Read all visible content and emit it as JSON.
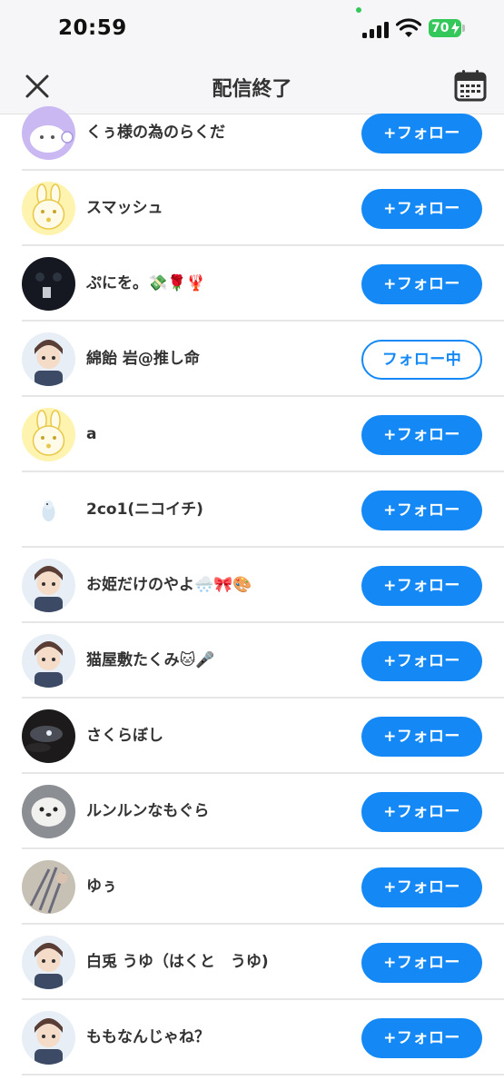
{
  "status_bar": {
    "time": "20:59",
    "battery": "70"
  },
  "nav": {
    "title": "配信終了"
  },
  "users": [
    {
      "name": "くぅ様の為のらくだ",
      "button": "+フォロー",
      "following": false,
      "avatar": "purple-plush-icon"
    },
    {
      "name": "スマッシュ",
      "button": "+フォロー",
      "following": false,
      "avatar": "yellow-bunny-icon"
    },
    {
      "name": "ぷにを。💸🌹🦞",
      "button": "+フォロー",
      "following": false,
      "avatar": "dark-face-icon"
    },
    {
      "name": "綿飴 岩@推し命",
      "button": "フォロー中",
      "following": true,
      "avatar": "anime-character-icon"
    },
    {
      "name": "a",
      "button": "+フォロー",
      "following": false,
      "avatar": "yellow-bunny-icon"
    },
    {
      "name": "2co1(ニコイチ)",
      "button": "+フォロー",
      "following": false,
      "avatar": "small-bird-icon"
    },
    {
      "name": "お姫だけのやよ🌨️🎀🎨",
      "button": "+フォロー",
      "following": false,
      "avatar": "anime-character-icon"
    },
    {
      "name": "猫屋敷たくみ🐱🎤",
      "button": "+フォロー",
      "following": false,
      "avatar": "anime-character-icon"
    },
    {
      "name": "さくらぼし",
      "button": "+フォロー",
      "following": false,
      "avatar": "night-sky-icon"
    },
    {
      "name": "ルンルンなもぐら",
      "button": "+フォロー",
      "following": false,
      "avatar": "white-seal-icon"
    },
    {
      "name": "ゆぅ",
      "button": "+フォロー",
      "following": false,
      "avatar": "flower-photo-icon"
    },
    {
      "name": "白兎 うゆ（はくと　うゆ)",
      "button": "+フォロー",
      "following": false,
      "avatar": "anime-character-icon"
    },
    {
      "name": "ももなんじゃね？",
      "button": "+フォロー",
      "following": false,
      "avatar": "anime-character-icon"
    }
  ],
  "colors": {
    "accent": "#1489f5",
    "battery": "#34c759",
    "divider": "#e6e6e6"
  }
}
